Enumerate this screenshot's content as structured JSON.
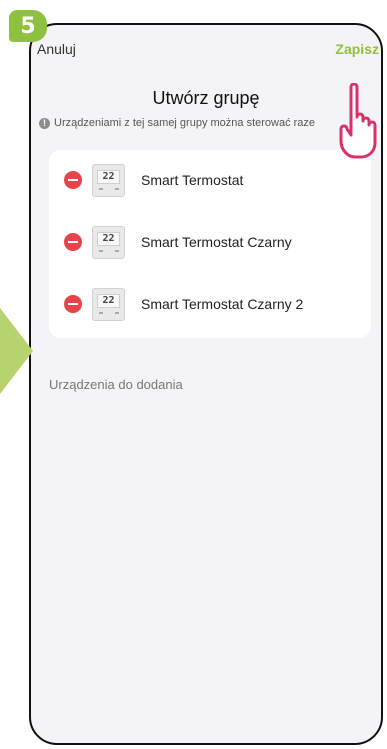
{
  "step_badge": "5",
  "topbar": {
    "cancel_label": "Anuluj",
    "save_label": "Zapisz"
  },
  "title": "Utwórz grupę",
  "hint": "Urządzeniami z tej samej grupy można sterować raze",
  "devices": [
    {
      "name": "Smart Termostat",
      "display": "22"
    },
    {
      "name": "Smart Termostat Czarny",
      "display": "22"
    },
    {
      "name": "Smart Termostat Czarny 2",
      "display": "22"
    }
  ],
  "section_label": "Urządzenia do dodania",
  "colors": {
    "accent": "#8ec13f",
    "remove": "#e8434a",
    "arrow": "#b6d36f"
  },
  "icons": [
    "info-icon",
    "remove-icon",
    "thermostat-icon",
    "pointing-hand-icon"
  ]
}
